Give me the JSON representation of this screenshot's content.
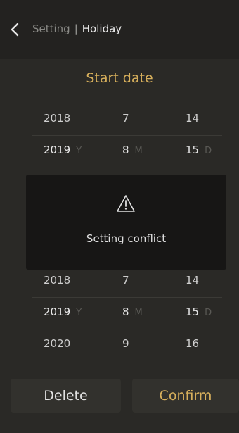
{
  "header": {
    "back_icon": "chevron-left-icon",
    "breadcrumb_parent": "Setting",
    "breadcrumb_separator": "|",
    "title": "Holiday"
  },
  "start_date": {
    "title": "Start date",
    "rows": [
      {
        "year": "2018",
        "month": "7",
        "day": "14"
      },
      {
        "year": "2019",
        "month": "8",
        "day": "15"
      }
    ],
    "units": {
      "year": "Y",
      "month": "M",
      "day": "D"
    }
  },
  "end_date": {
    "rows": [
      {
        "year": "2018",
        "month": "7",
        "day": "14"
      },
      {
        "year": "2019",
        "month": "8",
        "day": "15"
      },
      {
        "year": "2020",
        "month": "9",
        "day": "16"
      }
    ],
    "units": {
      "year": "Y",
      "month": "M",
      "day": "D"
    }
  },
  "overlay": {
    "icon": "warning-icon",
    "message": "Setting conflict"
  },
  "buttons": {
    "delete": "Delete",
    "confirm": "Confirm"
  },
  "colors": {
    "accent": "#d8b05c",
    "background": "#1d1c1a",
    "overlay": "#171615"
  }
}
